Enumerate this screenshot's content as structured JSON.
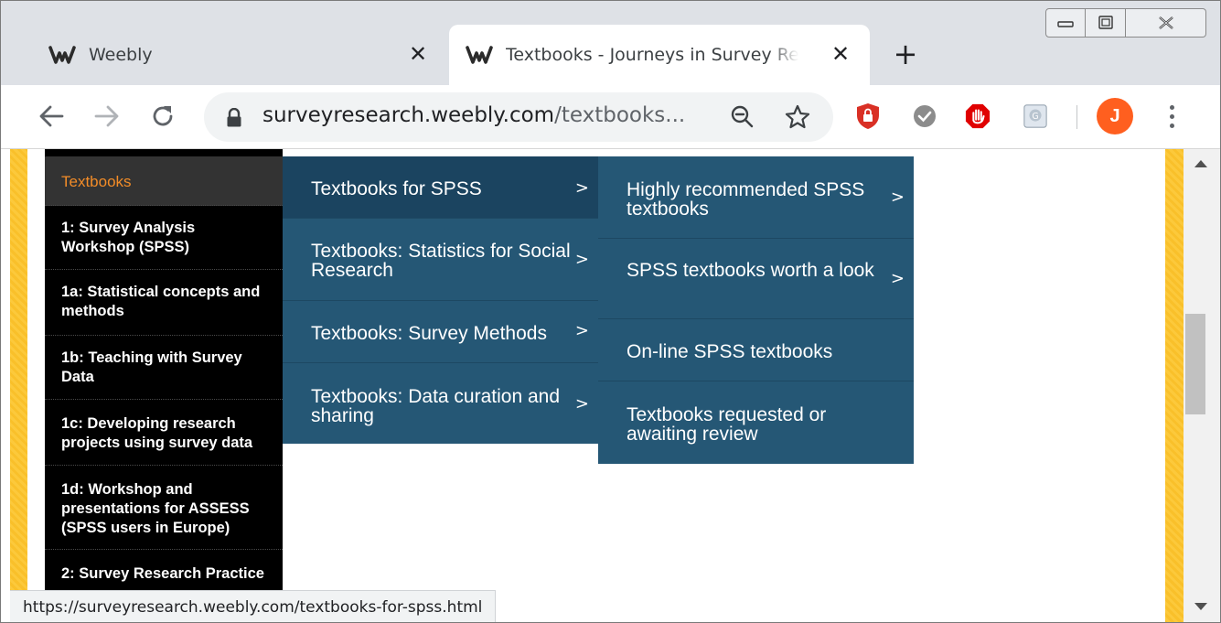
{
  "browser": {
    "tabs": [
      {
        "title": "Weebly"
      },
      {
        "title": "Textbooks - Journeys in Survey Research"
      }
    ],
    "address": {
      "host": "surveyresearch.weebly.com",
      "path": "/textbooks..."
    },
    "avatar_initial": "J",
    "status_url": "https://surveyresearch.weebly.com/textbooks-for-spss.html"
  },
  "sidebar": {
    "items": [
      {
        "label": "Textbooks"
      },
      {
        "label": "1: Survey Analysis Workshop (SPSS)"
      },
      {
        "label": "1a: Statistical concepts and methods"
      },
      {
        "label": "1b: Teaching with Survey Data"
      },
      {
        "label": "1c: Developing research projects using survey data"
      },
      {
        "label": "1d: Workshop and presentations for ASSESS (SPSS users in Europe)"
      },
      {
        "label": "2: Survey Research Practice"
      }
    ]
  },
  "submenu_level1": {
    "items": [
      {
        "label": "Textbooks for SPSS",
        "chevron": ">"
      },
      {
        "label": "Textbooks: Statistics for Social Research",
        "chevron": ">"
      },
      {
        "label": "Textbooks: Survey Methods",
        "chevron": ">"
      },
      {
        "label": "Textbooks: Data curation and sharing",
        "chevron": ">"
      }
    ]
  },
  "submenu_level2": {
    "items": [
      {
        "label": "Highly recommended SPSS textbooks",
        "chevron": ">"
      },
      {
        "label": "SPSS textbooks worth a look",
        "chevron": ">"
      },
      {
        "label": "On-line SPSS textbooks"
      },
      {
        "label": "Textbooks requested or awaiting review"
      }
    ]
  },
  "colors": {
    "menu_bg": "#255775",
    "menu_hover": "#1b4460",
    "accent_orange": "#f28c28",
    "side_stripe": "#f9c02a",
    "avatar_bg": "#ff5f1f"
  },
  "icons": [
    "weebly-icon",
    "close-icon",
    "plus-icon",
    "minimize-icon",
    "maximize-icon",
    "window-close-icon",
    "back-arrow-icon",
    "forward-arrow-icon",
    "reload-icon",
    "lock-icon",
    "zoom-out-icon",
    "star-icon",
    "shield-extension-icon",
    "check-extension-icon",
    "stop-hand-extension-icon",
    "grammar-extension-icon",
    "more-menu-icon"
  ]
}
